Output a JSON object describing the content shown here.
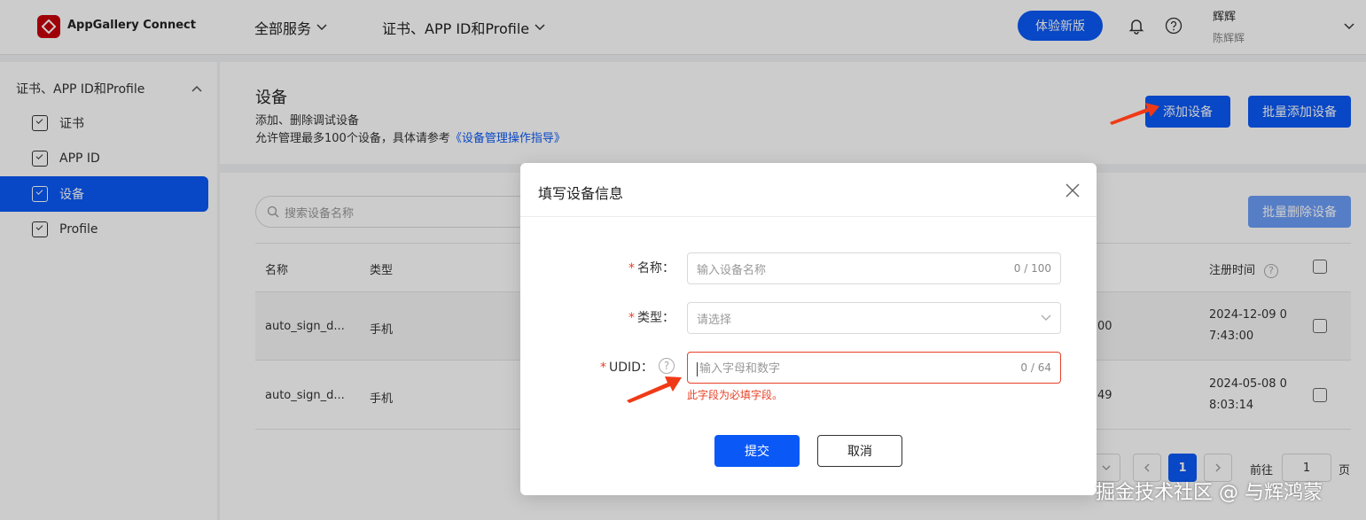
{
  "header": {
    "brand": "AppGallery Connect",
    "nav_all_services": "全部服务",
    "nav_cert": "证书、APP ID和Profile",
    "try_new": "体验新版",
    "user_name": "辉辉",
    "user_sub": "陈辉辉"
  },
  "sidebar": {
    "group_label": "证书、APP ID和Profile",
    "items": [
      {
        "label": "证书",
        "active": false
      },
      {
        "label": "APP ID",
        "active": false
      },
      {
        "label": "设备",
        "active": true
      },
      {
        "label": "Profile",
        "active": false
      }
    ]
  },
  "page": {
    "title": "设备",
    "desc1": "添加、删除调试设备",
    "desc2_prefix": "允许管理最多100个设备，具体请参考",
    "desc2_link": "《设备管理操作指导》",
    "add_device": "添加设备",
    "batch_add": "批量添加设备",
    "batch_delete": "批量删除设备",
    "search_placeholder": "搜索设备名称"
  },
  "table": {
    "col_name": "名称",
    "col_type": "类型",
    "col_reg_time": "注册时间",
    "rows": [
      {
        "name": "auto_sign_d...",
        "type": "手机",
        "udid_tail": "00",
        "reg_time_1": "2024-12-09 0",
        "reg_time_2": "7:43:00"
      },
      {
        "name": "auto_sign_d...",
        "type": "手机",
        "udid_tail": "49",
        "reg_time_1": "2024-05-08 0",
        "reg_time_2": "8:03:14"
      }
    ]
  },
  "pager": {
    "current": "1",
    "goto_label": "前往",
    "goto_value": "1",
    "page_suffix": "页"
  },
  "dialog": {
    "title": "填写设备信息",
    "name_label": "名称：",
    "name_placeholder": "输入设备名称",
    "name_count": "0 / 100",
    "type_label": "类型：",
    "type_placeholder": "请选择",
    "udid_label": "UDID：",
    "udid_placeholder": "输入字母和数字",
    "udid_count": "0 / 64",
    "udid_error": "此字段为必填字段。",
    "required_mark": "*",
    "submit": "提交",
    "cancel": "取消"
  },
  "watermark": "掘金技术社区 @ 与辉鸿蒙",
  "colors": {
    "primary": "#0a59f7",
    "error": "#e84026",
    "brand_red": "#c7000b"
  }
}
